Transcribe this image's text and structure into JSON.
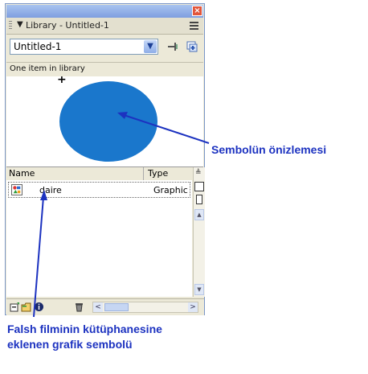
{
  "panel": {
    "title": "Library - Untitled-1",
    "close_glyph": "×",
    "collapse_glyph": "▼",
    "document_select": {
      "value": "Untitled-1",
      "arrow": "▼"
    },
    "item_count_text": "One item in library",
    "columns": {
      "name": "Name",
      "type": "Type"
    },
    "items": [
      {
        "name": "daire",
        "type": "Graphic",
        "icon": "graphic-symbol-icon"
      }
    ],
    "preview": {
      "shape": "ellipse",
      "fill": "#1a77cc",
      "reg_mark": "+"
    },
    "scroll_arrows": {
      "up": "▲",
      "down": "▼",
      "left": "<",
      "right": ">"
    },
    "sort_glyph": "≜"
  },
  "annotations": {
    "preview_note": "Sembolün önizlemesi",
    "symbol_note_line1": "Falsh filminin kütüphanesine",
    "symbol_note_line2": "eklenen grafik sembolü",
    "color": "#1c32c0"
  },
  "colors": {
    "panel_bg": "#ece9d8",
    "titlebar_bg": "#e3e0cf",
    "accent_blue": "#7e9ee0"
  }
}
